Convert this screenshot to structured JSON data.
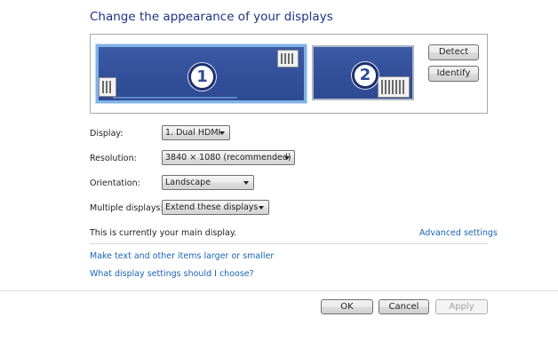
{
  "title": "Change the appearance of your displays",
  "preview": {
    "monitors": [
      {
        "number": "1",
        "primary": true
      },
      {
        "number": "2",
        "primary": false
      }
    ],
    "detect_label": "Detect",
    "identify_label": "Identify"
  },
  "settings": {
    "display": {
      "label": "Display:",
      "value": "1. Dual HDMI"
    },
    "resolution": {
      "label": "Resolution:",
      "value": "3840 × 1080 (recommended)"
    },
    "orientation": {
      "label": "Orientation:",
      "value": "Landscape"
    },
    "multiple_displays": {
      "label": "Multiple displays:",
      "value": "Extend these displays"
    }
  },
  "main_display_note": "This is currently your main display.",
  "links": {
    "advanced": "Advanced settings",
    "larger_text": "Make text and other items larger or smaller",
    "which_settings": "What display settings should I choose?"
  },
  "footer": {
    "ok_label": "OK",
    "cancel_label": "Cancel",
    "apply_label": "Apply",
    "apply_enabled": false
  },
  "colors": {
    "title": "#1e3287",
    "link": "#1a63b8",
    "monitor_fill": "#34509b",
    "selected_border": "#7fb1e5"
  }
}
